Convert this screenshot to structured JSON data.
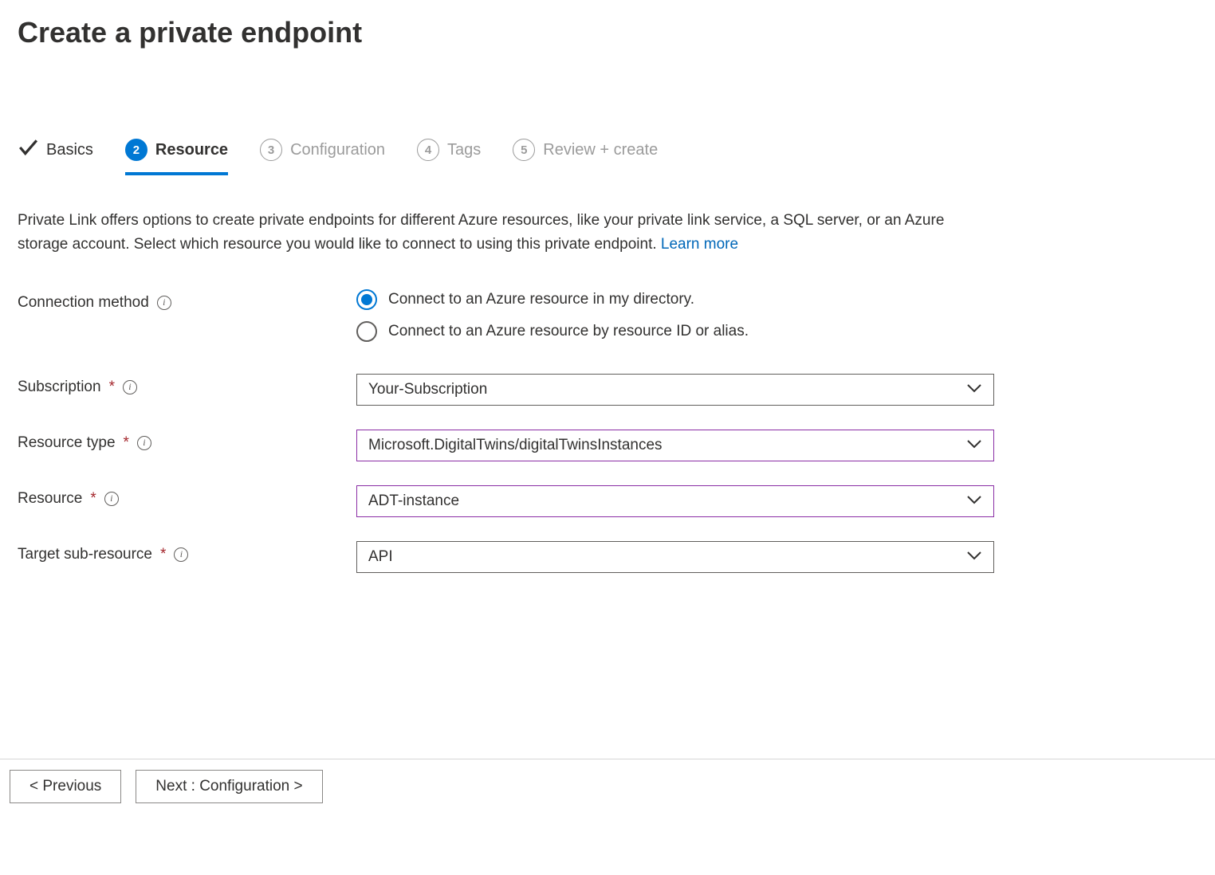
{
  "header": {
    "title": "Create a private endpoint"
  },
  "tabs": [
    {
      "label": "Basics",
      "state": "done"
    },
    {
      "label": "Resource",
      "state": "active",
      "num": "2"
    },
    {
      "label": "Configuration",
      "state": "future",
      "num": "3"
    },
    {
      "label": "Tags",
      "state": "future",
      "num": "4"
    },
    {
      "label": "Review + create",
      "state": "future",
      "num": "5"
    }
  ],
  "description": {
    "text": "Private Link offers options to create private endpoints for different Azure resources, like your private link service, a SQL server, or an Azure storage account. Select which resource you would like to connect to using this private endpoint.  ",
    "learn_more": "Learn more"
  },
  "fields": {
    "connection_method": {
      "label": "Connection method",
      "options": [
        "Connect to an Azure resource in my directory.",
        "Connect to an Azure resource by resource ID or alias."
      ],
      "selected_index": 0
    },
    "subscription": {
      "label": "Subscription",
      "value": "Your-Subscription"
    },
    "resource_type": {
      "label": "Resource type",
      "value": "Microsoft.DigitalTwins/digitalTwinsInstances"
    },
    "resource": {
      "label": "Resource",
      "value": "ADT-instance"
    },
    "target_sub": {
      "label": "Target sub-resource",
      "value": "API"
    }
  },
  "footer": {
    "previous": "<  Previous",
    "next": "Next : Configuration  >"
  }
}
